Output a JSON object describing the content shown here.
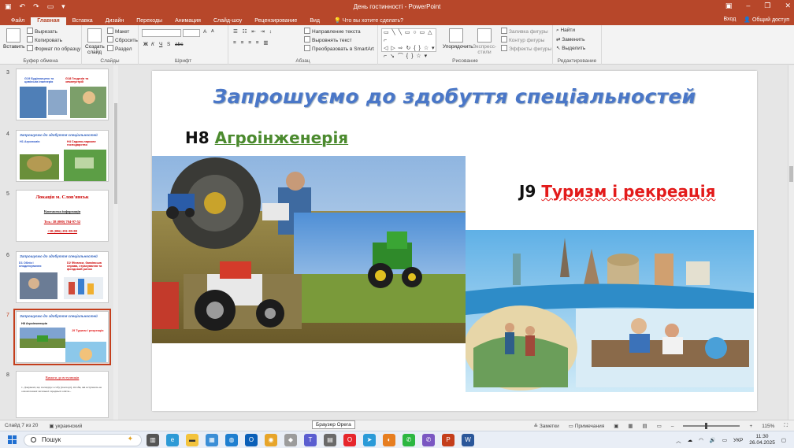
{
  "window": {
    "title": "День гостинності - PowerPoint",
    "signin": "Вход",
    "share": "Общий доступ"
  },
  "tabs": [
    {
      "label": "Файл"
    },
    {
      "label": "Главная",
      "active": true
    },
    {
      "label": "Вставка"
    },
    {
      "label": "Дизайн"
    },
    {
      "label": "Переходы"
    },
    {
      "label": "Анимация"
    },
    {
      "label": "Слайд-шоу"
    },
    {
      "label": "Рецензирование"
    },
    {
      "label": "Вид"
    }
  ],
  "tell_me": "Что вы хотите сделать?",
  "ribbon": {
    "clipboard": {
      "label": "Буфер обмена",
      "paste": "Вставить",
      "cut": "Вырезать",
      "copy": "Копировать",
      "format_painter": "Формат по образцу"
    },
    "slides": {
      "label": "Слайды",
      "new_slide": "Создать слайд",
      "layout": "Макет",
      "reset": "Сбросить",
      "section": "Раздел"
    },
    "font": {
      "label": "Шрифт",
      "bold": "Ж",
      "italic": "К",
      "underline": "Ч",
      "strike": "S",
      "shadow": "abc",
      "grow": "A",
      "shrink": "A"
    },
    "paragraph": {
      "label": "Абзац",
      "text_direction": "Направление текста",
      "align_text": "Выровнять текст",
      "smartart": "Преобразовать в SmartArt"
    },
    "drawing": {
      "label": "Рисование",
      "arrange": "Упорядочить",
      "quick_styles": "Экспресс-стили",
      "fill": "Заливка фигуры",
      "outline": "Контур фигуры",
      "effects": "Эффекты фигуры"
    },
    "editing": {
      "label": "Редактирование",
      "find": "Найти",
      "replace": "Заменить",
      "select": "Выделить"
    }
  },
  "thumbnails": [
    {
      "num": "3",
      "title": "Запрошуємо до здобуття спеціальностей",
      "sub1": "G19 Будівництво та цивільна інженерія",
      "sub2": "G18 Геодезія та землеустрій"
    },
    {
      "num": "4",
      "title": "Запрошуємо до здобуття спеціальностей",
      "sub1": "Н1 Агрономія",
      "sub2": "Н4 Садово-паркове господарство"
    },
    {
      "num": "5",
      "title": "Локація м. Слов'янськ",
      "sub1": "Контактна інформація",
      "sub2": "Тел.: 38 (000) 704-97-52",
      "sub3": "+38 (096) 291-89-88"
    },
    {
      "num": "6",
      "title": "Запрошуємо до здобуття спеціальностей",
      "sub1": "D1 Облік і оподаткування",
      "sub2": "D2 Фінанси, банківська справа, страхування та фондовий ринок"
    },
    {
      "num": "7",
      "title": "Запрошуємо до здобуття спеціальностей",
      "sub1": "H8 Агроінженерія",
      "sub2": "J9 Туризм і рекреація",
      "selected": true
    },
    {
      "num": "8",
      "title": "Вимоги до вступників",
      "sub1": "1. Документ, що посвідчує особу (паспорт). Особи, які вступають на основі повної загальної середньої освіти..."
    }
  ],
  "slide": {
    "title": "Запрошуємо до здобуття спеціальностей",
    "spec1_code": "H8",
    "spec1_name": "Агроінженерія",
    "spec2_code": "J9",
    "spec2_name": "Туризм і рекреація"
  },
  "status": {
    "slide_info": "Слайд 7 из 20",
    "language": "украинский",
    "notes": "Заметки",
    "comments": "Примечания",
    "zoom": "115%",
    "tooltip": "Браузер Opera"
  },
  "taskbar": {
    "search_placeholder": "Пошук",
    "lang": "УКР",
    "time": "11:30",
    "date": "26.04.2025"
  },
  "colors": {
    "accent": "#b7472a",
    "title_blue": "#4a77c8",
    "green": "#4b8a2e",
    "red": "#e31b1b"
  }
}
